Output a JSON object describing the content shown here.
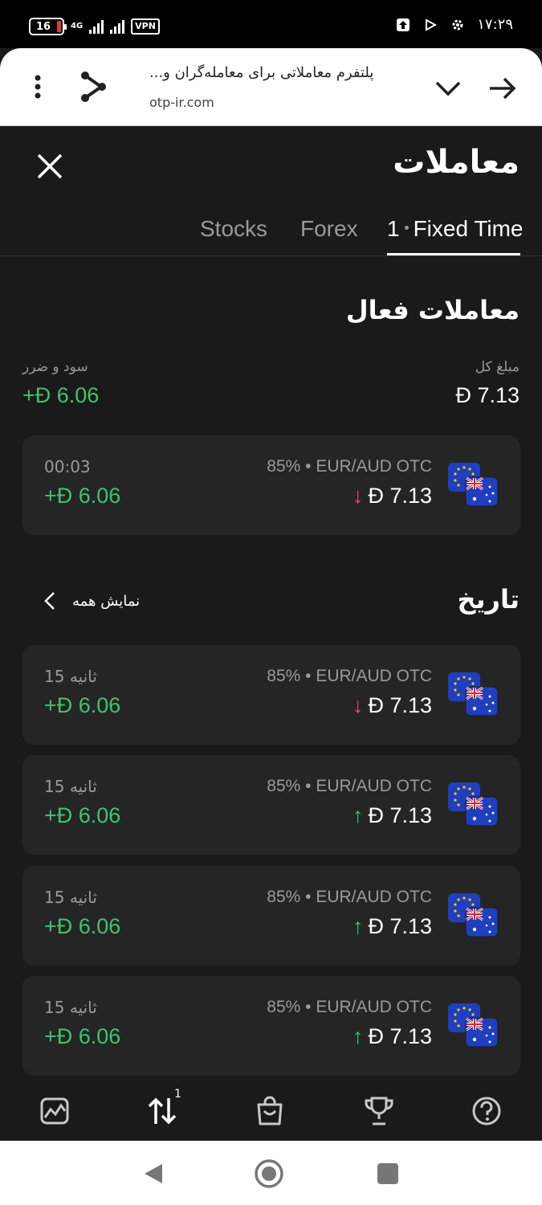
{
  "status_bar": {
    "battery": "16",
    "network": "4G",
    "vpn": "VPN",
    "time": "۱۷:۲۹"
  },
  "browser": {
    "title": "پلتفرم معاملاتی برای معامله‌گران و...",
    "url": "otp-ir.com"
  },
  "panel": {
    "title": "معاملات",
    "tabs": [
      {
        "label": "Stocks",
        "active": false
      },
      {
        "label": "Forex",
        "active": false
      },
      {
        "label": "Fixed Time",
        "count": "1",
        "active": true
      }
    ]
  },
  "active_trades": {
    "title": "معاملات فعال",
    "total_label": "مبلغ کل",
    "total_value": "Đ 7.13",
    "pnl_label": "سود و ضرر",
    "pnl_value": "+Đ 6.06",
    "items": [
      {
        "pair": "85% • EUR/AUD OTC",
        "amount": "Đ 7.13",
        "direction": "↓",
        "time": "00:03",
        "profit": "+Đ 6.06"
      }
    ]
  },
  "history": {
    "title": "تاریخ",
    "show_all": "نمایش همه",
    "items": [
      {
        "pair": "85% • EUR/AUD OTC",
        "amount": "Đ 7.13",
        "direction": "↓",
        "time": "15 ثانیه",
        "profit": "+Đ 6.06"
      },
      {
        "pair": "85% • EUR/AUD OTC",
        "amount": "Đ 7.13",
        "direction": "↑",
        "time": "15 ثانیه",
        "profit": "+Đ 6.06"
      },
      {
        "pair": "85% • EUR/AUD OTC",
        "amount": "Đ 7.13",
        "direction": "↑",
        "time": "15 ثانیه",
        "profit": "+Đ 6.06"
      },
      {
        "pair": "85% • EUR/AUD OTC",
        "amount": "Đ 7.13",
        "direction": "↑",
        "time": "15 ثانیه",
        "profit": "+Đ 6.06"
      }
    ]
  },
  "bottom_nav": {
    "trades_badge": "1",
    "icons": [
      "chart-icon",
      "trades-icon",
      "market-icon",
      "trophy-icon",
      "help-icon"
    ]
  },
  "colors": {
    "background": "#1a1a1a",
    "card": "#252525",
    "profit_green": "#3ec46d",
    "loss_red": "#ef4b5a",
    "muted": "#9a9a9a"
  }
}
